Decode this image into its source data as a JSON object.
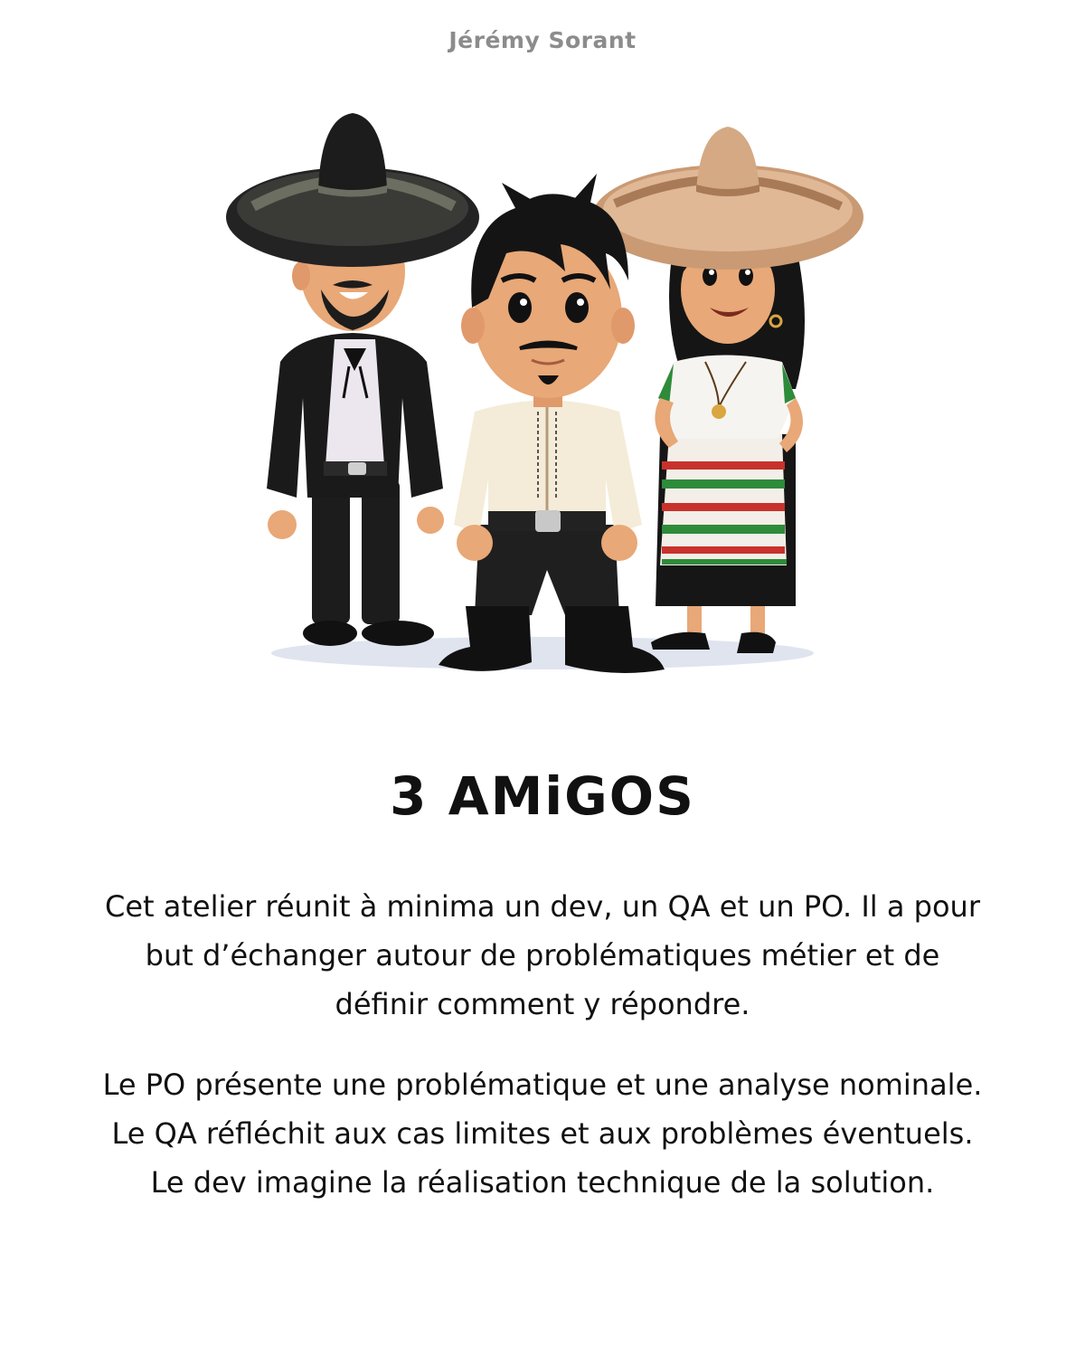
{
  "header": {
    "author": "Jérémy Sorant"
  },
  "illustration": {
    "characters": [
      "man-black-charro-suit",
      "man-white-shirt-center",
      "woman-mexican-dress"
    ],
    "colors": {
      "suit": "#1a1a1a",
      "sombrero_dark": "#2b2b2b",
      "sombrero_band": "#6b6e60",
      "sombrero_tan": "#d9b08c",
      "skin": "#e8a877",
      "shirt_cream": "#f4ecd8",
      "skirt_green": "#2e8b3a",
      "skirt_red": "#c8322c",
      "shadow": "#d5dbe8"
    }
  },
  "content": {
    "title": "3 AMiGOS",
    "paragraph_1": "Cet atelier réunit à minima un dev, un QA et un PO. Il a pour but d’échanger autour de problématiques métier et de définir comment y répondre.",
    "paragraph_2": "Le PO présente une problématique et une analyse nominale. Le QA réfléchit aux cas limites et aux problèmes éventuels. Le dev imagine la réalisation technique de la solution."
  }
}
